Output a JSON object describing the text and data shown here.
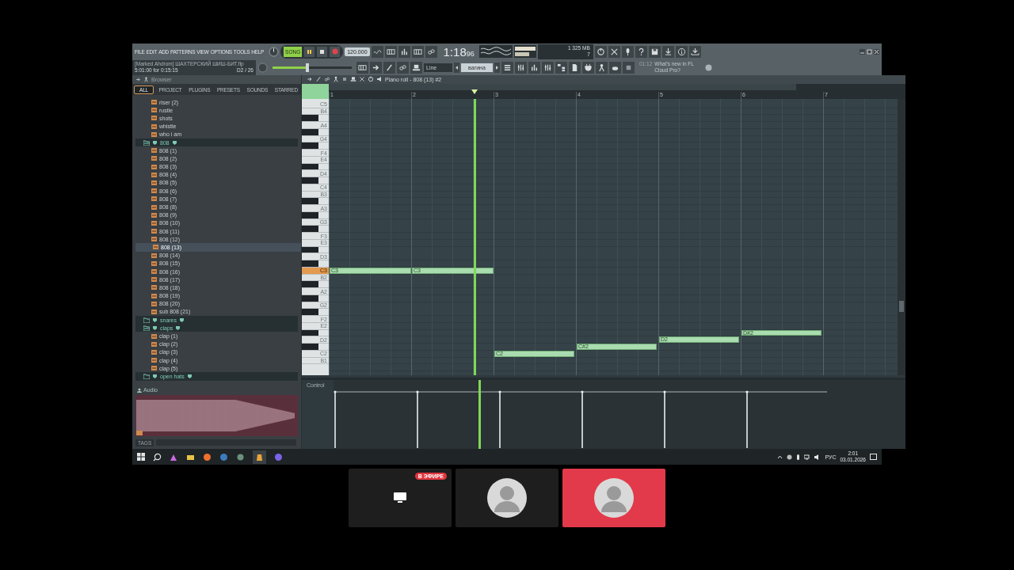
{
  "toolbar": {
    "menu": [
      "FILE",
      "EDIT",
      "ADD",
      "PATTERNS",
      "VIEW",
      "OPTIONS",
      "TOOLS",
      "HELP"
    ],
    "hint_title": "[Marked Ahdrom] ШАХТЕРСКИЙ ШИШ-БИТ.flp",
    "hint_time": "5:01:00 for 0:15:15",
    "hint_count": "D2 / 26",
    "song_label": "SONG",
    "tempo": "120.000",
    "time": "1:18",
    "time_cs": "96",
    "memory": "325 MB",
    "voices": "7",
    "cpu": "1",
    "master_volume": {
      "level": 0.44
    },
    "snap": "Line",
    "pattern": "вагина",
    "news_time": "01:12",
    "news": "What's new in FL Cloud Pro?"
  },
  "browser": {
    "title": "Browser",
    "tabs": [
      {
        "label": "ALL",
        "selected": true
      },
      {
        "label": "PROJECT",
        "selected": false
      },
      {
        "label": "PLUGINS",
        "selected": false
      },
      {
        "label": "PRESETS",
        "selected": false
      },
      {
        "label": "SOUNDS",
        "selected": false
      },
      {
        "label": "STARRED",
        "selected": false
      }
    ],
    "items": [
      {
        "kind": "file",
        "label": "riser (2)",
        "selected": false
      },
      {
        "kind": "file",
        "label": "rustle",
        "selected": false
      },
      {
        "kind": "file",
        "label": "shots",
        "selected": false
      },
      {
        "kind": "file",
        "label": "whistle",
        "selected": false
      },
      {
        "kind": "file",
        "label": "who i am",
        "selected": false
      },
      {
        "kind": "folder",
        "label": "808",
        "expanded": true,
        "selected": false,
        "children": [
          {
            "kind": "file",
            "label": "808 (1)",
            "selected": false
          },
          {
            "kind": "file",
            "label": "808 (2)",
            "selected": false
          },
          {
            "kind": "file",
            "label": "808 (3)",
            "selected": false
          },
          {
            "kind": "file",
            "label": "808 (4)",
            "selected": false
          },
          {
            "kind": "file",
            "label": "808 (5)",
            "selected": false
          },
          {
            "kind": "file",
            "label": "808 (6)",
            "selected": false
          },
          {
            "kind": "file",
            "label": "808 (7)",
            "selected": false
          },
          {
            "kind": "file",
            "label": "808 (8)",
            "selected": false
          },
          {
            "kind": "file",
            "label": "808 (9)",
            "selected": false
          },
          {
            "kind": "file",
            "label": "808 (10)",
            "selected": false
          },
          {
            "kind": "file",
            "label": "808 (11)",
            "selected": false
          },
          {
            "kind": "file",
            "label": "808 (12)",
            "selected": false
          },
          {
            "kind": "file",
            "label": "808 (13)",
            "selected": true
          },
          {
            "kind": "file",
            "label": "808 (14)",
            "selected": false
          },
          {
            "kind": "file",
            "label": "808 (15)",
            "selected": false
          },
          {
            "kind": "file",
            "label": "808 (16)",
            "selected": false
          },
          {
            "kind": "file",
            "label": "808 (17)",
            "selected": false
          },
          {
            "kind": "file",
            "label": "808 (18)",
            "selected": false
          },
          {
            "kind": "file",
            "label": "808 (19)",
            "selected": false
          },
          {
            "kind": "file",
            "label": "808 (20)",
            "selected": false
          },
          {
            "kind": "file",
            "label": "sub 808 (21)",
            "selected": false
          }
        ]
      },
      {
        "kind": "folder",
        "label": "snares",
        "expanded": false,
        "selected": false
      },
      {
        "kind": "folder",
        "label": "claps",
        "expanded": true,
        "selected": false,
        "children": [
          {
            "kind": "file",
            "label": "clap (1)",
            "selected": false
          },
          {
            "kind": "file",
            "label": "clap (2)",
            "selected": false
          },
          {
            "kind": "file",
            "label": "clap (3)",
            "selected": false
          },
          {
            "kind": "file",
            "label": "clap (4)",
            "selected": false
          },
          {
            "kind": "file",
            "label": "clap (5)",
            "selected": false
          }
        ]
      },
      {
        "kind": "folder",
        "label": "open hats",
        "expanded": false,
        "selected": false
      }
    ],
    "audio_label": "Audio",
    "tags_label": "TAGS"
  },
  "piano_roll": {
    "title": "Piano roll - 808 (13) #2",
    "bars": [
      "1",
      "2",
      "3",
      "4",
      "5",
      "6",
      "7"
    ],
    "keys": [
      {
        "kind": "white",
        "label": "C5",
        "active": false
      },
      {
        "kind": "white",
        "label": "B4",
        "active": false
      },
      {
        "kind": "black",
        "active": false
      },
      {
        "kind": "white",
        "label": "A4",
        "active": false
      },
      {
        "kind": "black",
        "active": false
      },
      {
        "kind": "white",
        "label": "G4",
        "active": false
      },
      {
        "kind": "black",
        "active": false
      },
      {
        "kind": "white",
        "label": "F4",
        "active": false
      },
      {
        "kind": "white",
        "label": "E4",
        "active": false
      },
      {
        "kind": "black",
        "active": false
      },
      {
        "kind": "white",
        "label": "D4",
        "active": false
      },
      {
        "kind": "black",
        "active": false
      },
      {
        "kind": "white",
        "label": "C4",
        "active": false
      },
      {
        "kind": "white",
        "label": "B3",
        "active": false
      },
      {
        "kind": "black",
        "active": false
      },
      {
        "kind": "white",
        "label": "A3",
        "active": false
      },
      {
        "kind": "black",
        "active": false
      },
      {
        "kind": "white",
        "label": "G3",
        "active": false
      },
      {
        "kind": "black",
        "active": false
      },
      {
        "kind": "white",
        "label": "F3",
        "active": false
      },
      {
        "kind": "white",
        "label": "E3",
        "active": false
      },
      {
        "kind": "black",
        "active": false
      },
      {
        "kind": "white",
        "label": "D3",
        "active": false
      },
      {
        "kind": "black",
        "active": false
      },
      {
        "kind": "white",
        "label": "C3",
        "active": true
      },
      {
        "kind": "white",
        "label": "B2",
        "active": false
      },
      {
        "kind": "black",
        "active": false
      },
      {
        "kind": "white",
        "label": "A2",
        "active": false
      },
      {
        "kind": "black",
        "active": false
      },
      {
        "kind": "white",
        "label": "G2",
        "active": false
      },
      {
        "kind": "black",
        "active": false
      },
      {
        "kind": "white",
        "label": "F2",
        "active": false
      },
      {
        "kind": "white",
        "label": "E2",
        "active": false
      },
      {
        "kind": "black",
        "active": false
      },
      {
        "kind": "white",
        "label": "D2",
        "active": false
      },
      {
        "kind": "black",
        "active": false
      },
      {
        "kind": "white",
        "label": "C2",
        "active": false
      },
      {
        "kind": "white",
        "label": "B1",
        "active": false
      }
    ],
    "notes": [
      {
        "label": "C3"
      },
      {
        "label": "C3"
      },
      {
        "label": "C2"
      },
      {
        "label": "C#2"
      },
      {
        "label": "D2"
      },
      {
        "label": "D#2"
      }
    ],
    "control_label": "Control"
  },
  "taskbar": {
    "language": "РУС",
    "clock": "2:01",
    "date": "03.01.2026"
  },
  "tiles": [
    {
      "kind": "screen",
      "badge": "В ЭФИРЕ",
      "color": "#1e1e1e"
    },
    {
      "kind": "avatar",
      "color": "#1e1e1e"
    },
    {
      "kind": "avatar",
      "color": "#e23a4a"
    }
  ]
}
